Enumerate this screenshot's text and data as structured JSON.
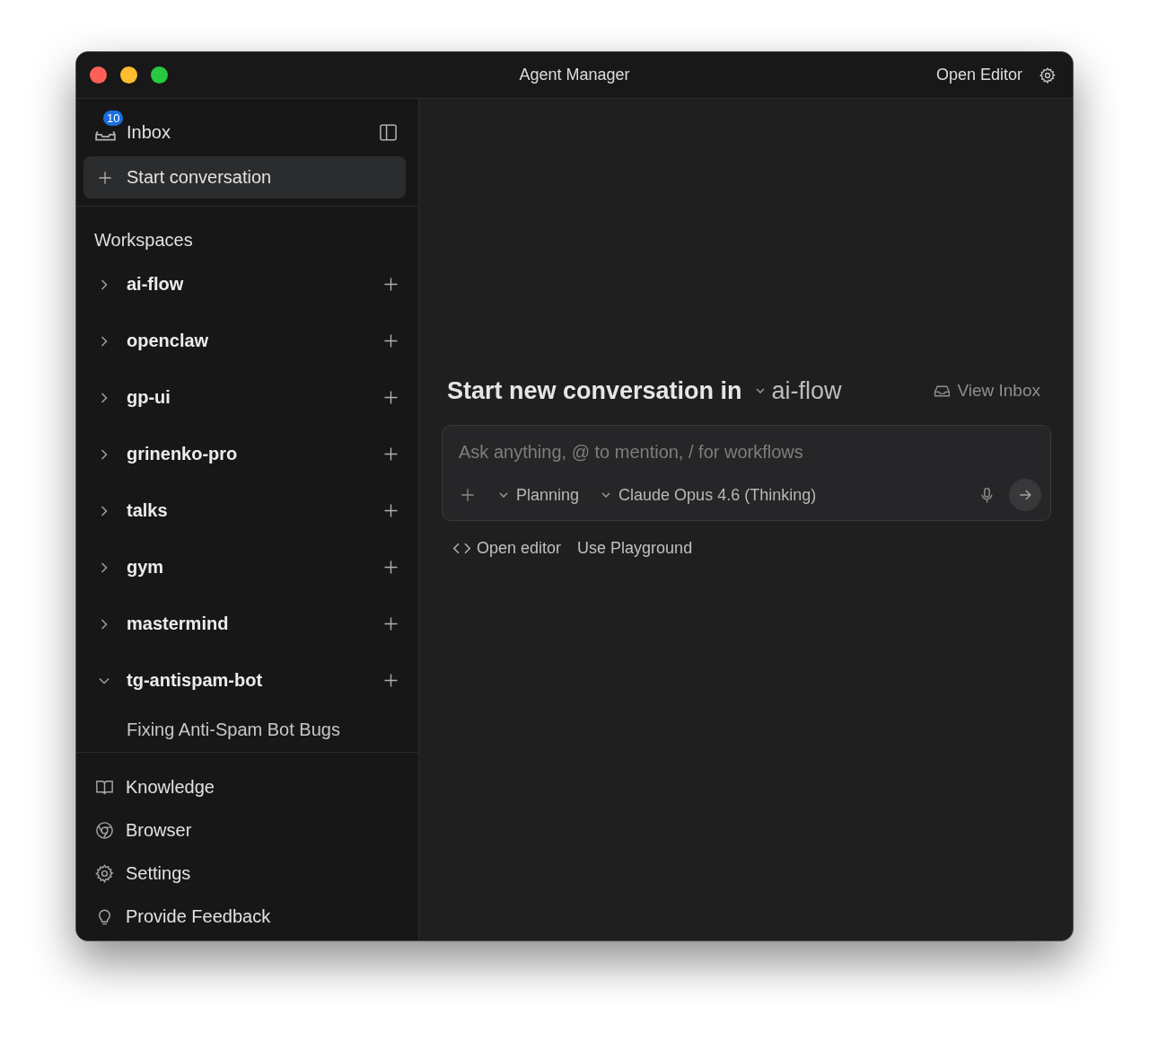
{
  "window": {
    "title": "Agent Manager",
    "open_editor": "Open Editor"
  },
  "sidebar": {
    "inbox": {
      "label": "Inbox",
      "badge": "10"
    },
    "start_button": "Start conversation",
    "workspaces_heading": "Workspaces",
    "workspaces": [
      {
        "name": "ai-flow",
        "expanded": false
      },
      {
        "name": "openclaw",
        "expanded": false
      },
      {
        "name": "gp-ui",
        "expanded": false
      },
      {
        "name": "grinenko-pro",
        "expanded": false
      },
      {
        "name": "talks",
        "expanded": false
      },
      {
        "name": "gym",
        "expanded": false
      },
      {
        "name": "mastermind",
        "expanded": false
      },
      {
        "name": "tg-antispam-bot",
        "expanded": true,
        "children": [
          {
            "name": "Fixing Anti-Spam Bot Bugs"
          }
        ]
      }
    ],
    "nav": [
      {
        "kind": "book",
        "label": "Knowledge"
      },
      {
        "kind": "browser",
        "label": "Browser"
      },
      {
        "kind": "gear",
        "label": "Settings"
      },
      {
        "kind": "bulb",
        "label": "Provide Feedback"
      }
    ]
  },
  "main": {
    "heading": "Start new conversation in",
    "workspace": "ai-flow",
    "view_inbox": "View Inbox",
    "composer": {
      "placeholder": "Ask anything, @ to mention, / for workflows",
      "mode": "Planning",
      "model": "Claude Opus 4.6 (Thinking)"
    },
    "links": [
      {
        "kind": "code",
        "label": "Open editor"
      },
      {
        "kind": "plain",
        "label": "Use Playground"
      }
    ]
  }
}
